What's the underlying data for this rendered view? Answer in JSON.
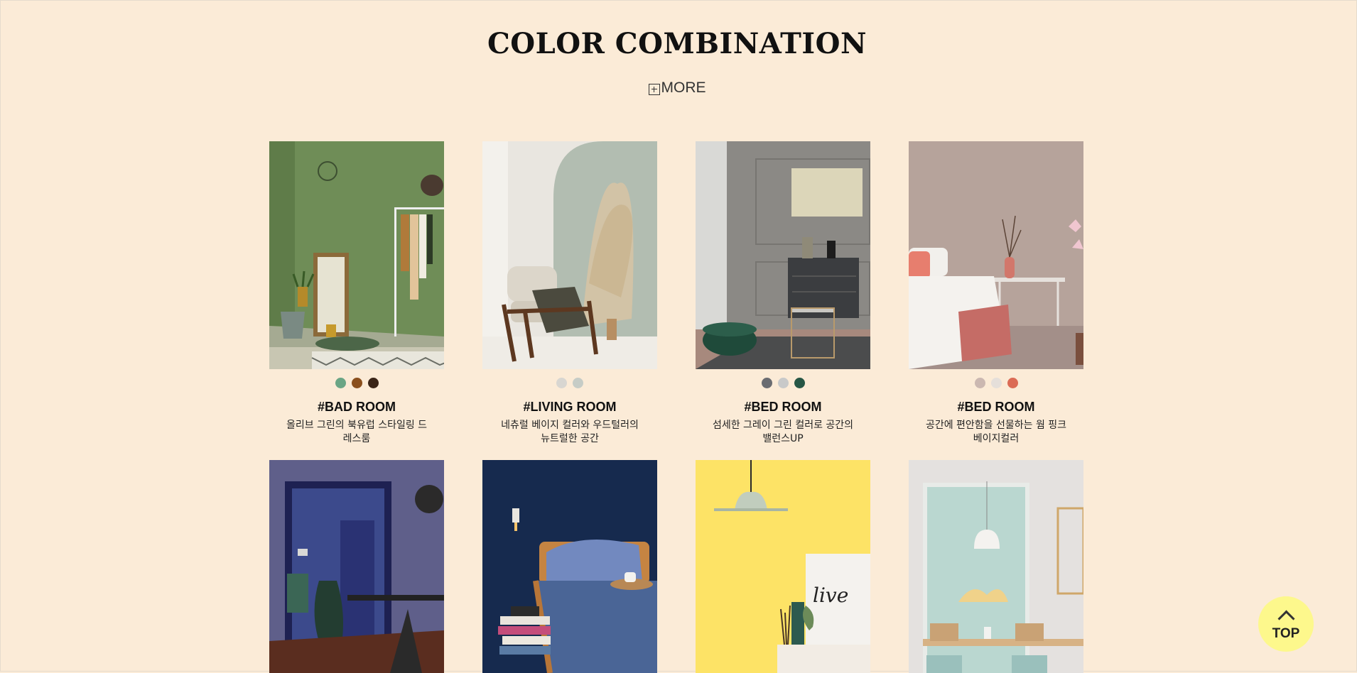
{
  "header": {
    "title": "COLOR COMBINATION",
    "more_label": "MORE"
  },
  "cards": [
    {
      "title": "#BAD ROOM",
      "desc": "올리브 그린의 북유럽 스타일링 드레스룸",
      "swatches": [
        "#6aa585",
        "#8a4f1c",
        "#3a2518"
      ]
    },
    {
      "title": "#LIVING ROOM",
      "desc": "네츄럴 베이지 컬러와 우드털러의 뉴트럴한 공간",
      "swatches": [
        "#d8d6d1",
        "#c6ccc6"
      ]
    },
    {
      "title": "#BED ROOM",
      "desc": "섬세한 그레이 그린 컬러로 공간의 밸런스UP",
      "swatches": [
        "#6a6c71",
        "#c8c9c9",
        "#265645"
      ]
    },
    {
      "title": "#BED ROOM",
      "desc": "공간에 편안함을 선물하는 웜 핑크 베이지컬러",
      "swatches": [
        "#cbb8b1",
        "#e5dfda",
        "#db6b55"
      ]
    }
  ],
  "bottom_cards": [
    "navy-dining-photo",
    "navy-bedroom-photo",
    "yellow-wall-photo",
    "mint-dining-photo"
  ],
  "top_button": {
    "label": "TOP"
  },
  "colors": {
    "background": "#fbebd7",
    "top_button": "#fdf88c"
  }
}
